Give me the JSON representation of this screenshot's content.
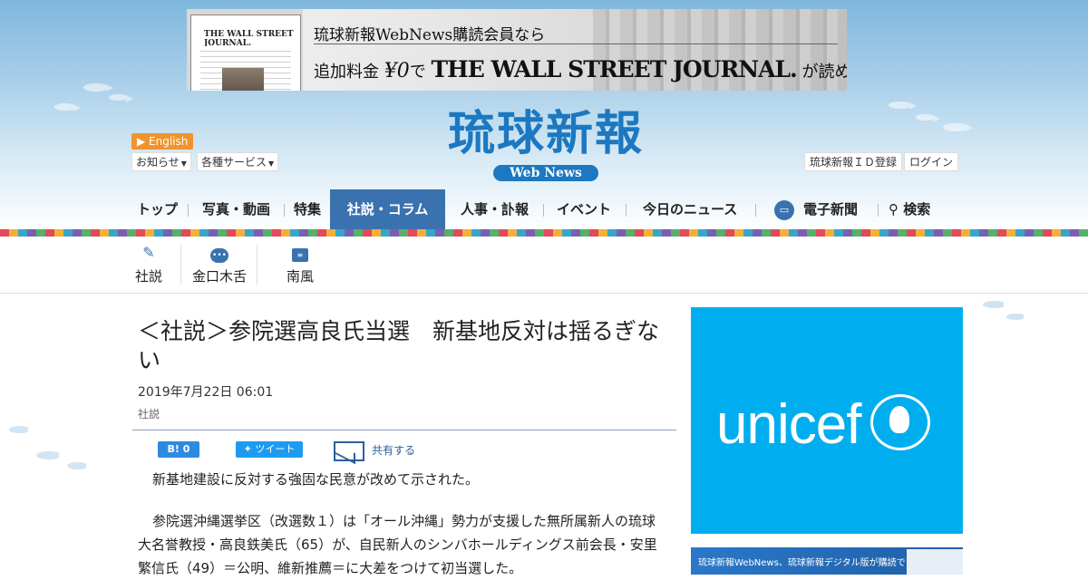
{
  "banner": {
    "line1": "琉球新報WebNews購読会員なら",
    "line2_pre": "追加料金",
    "line2_price": "¥0",
    "line2_mid": "で",
    "line2_wsj": "THE WALL STREET JOURNAL.",
    "line2_post": "が読める",
    "mini_title": "THE WALL STREET JOURNAL."
  },
  "header": {
    "logo": "琉球新報",
    "logo_sub": "Web News",
    "english": "English",
    "dropdowns": [
      "お知らせ",
      "各種サービス"
    ],
    "id_register": "琉球新報ＩＤ登録",
    "login": "ログイン"
  },
  "nav": {
    "items": [
      "トップ",
      "写真・動画",
      "特集",
      "社説・コラム",
      "人事・訃報",
      "イベント",
      "今日のニュース",
      "電子新聞",
      "検索"
    ],
    "active": "社説・コラム"
  },
  "subnav": {
    "items": [
      "社説",
      "金口木舌",
      "南風"
    ]
  },
  "article": {
    "title": "＜社説＞参院選高良氏当選　新基地反対は揺るぎない",
    "date": "2019年7月22日 06:01",
    "category": "社説",
    "hatena_count": "0",
    "tweet": "ツイート",
    "share": "共有する",
    "paragraphs": [
      "新基地建設に反対する強固な民意が改めて示された。",
      "参院選沖縄選挙区（改選数１）は「オール沖縄」勢力が支援した無所属新人の琉球大名誉教授・高良鉄美氏（65）が、自民新人のシンバホールディングス前会長・安里繁信氏（49）＝公明、維新推薦＝に大差をつけて初当選した。"
    ]
  },
  "sidebar": {
    "ad1_brand": "unicef",
    "ad2_text": "琉球新報WebNews、琉球新報デジタル版が購読できる"
  },
  "colors": {
    "brand_blue": "#1c78c0",
    "nav_active": "#3a72b0",
    "unicef": "#00aeef",
    "english_badge": "#f0932c"
  }
}
